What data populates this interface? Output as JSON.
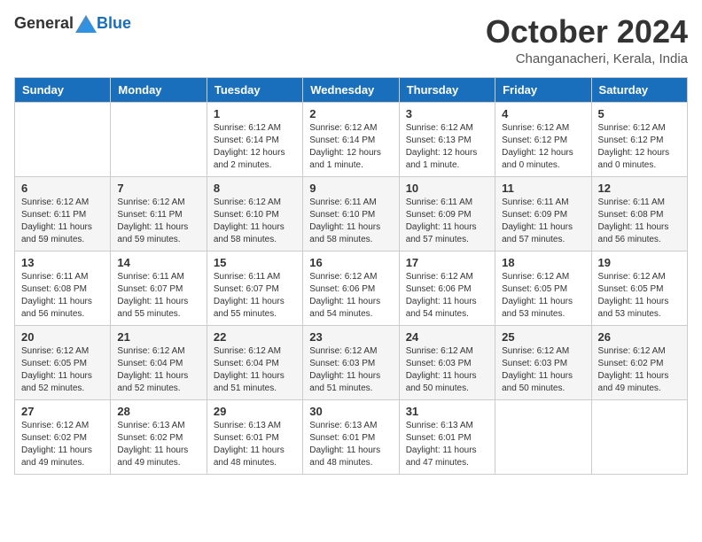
{
  "header": {
    "logo_general": "General",
    "logo_blue": "Blue",
    "month_title": "October 2024",
    "location": "Changanacheri, Kerala, India"
  },
  "calendar": {
    "days_of_week": [
      "Sunday",
      "Monday",
      "Tuesday",
      "Wednesday",
      "Thursday",
      "Friday",
      "Saturday"
    ],
    "weeks": [
      [
        {
          "day": "",
          "info": ""
        },
        {
          "day": "",
          "info": ""
        },
        {
          "day": "1",
          "info": "Sunrise: 6:12 AM\nSunset: 6:14 PM\nDaylight: 12 hours and 2 minutes."
        },
        {
          "day": "2",
          "info": "Sunrise: 6:12 AM\nSunset: 6:14 PM\nDaylight: 12 hours and 1 minute."
        },
        {
          "day": "3",
          "info": "Sunrise: 6:12 AM\nSunset: 6:13 PM\nDaylight: 12 hours and 1 minute."
        },
        {
          "day": "4",
          "info": "Sunrise: 6:12 AM\nSunset: 6:12 PM\nDaylight: 12 hours and 0 minutes."
        },
        {
          "day": "5",
          "info": "Sunrise: 6:12 AM\nSunset: 6:12 PM\nDaylight: 12 hours and 0 minutes."
        }
      ],
      [
        {
          "day": "6",
          "info": "Sunrise: 6:12 AM\nSunset: 6:11 PM\nDaylight: 11 hours and 59 minutes."
        },
        {
          "day": "7",
          "info": "Sunrise: 6:12 AM\nSunset: 6:11 PM\nDaylight: 11 hours and 59 minutes."
        },
        {
          "day": "8",
          "info": "Sunrise: 6:12 AM\nSunset: 6:10 PM\nDaylight: 11 hours and 58 minutes."
        },
        {
          "day": "9",
          "info": "Sunrise: 6:11 AM\nSunset: 6:10 PM\nDaylight: 11 hours and 58 minutes."
        },
        {
          "day": "10",
          "info": "Sunrise: 6:11 AM\nSunset: 6:09 PM\nDaylight: 11 hours and 57 minutes."
        },
        {
          "day": "11",
          "info": "Sunrise: 6:11 AM\nSunset: 6:09 PM\nDaylight: 11 hours and 57 minutes."
        },
        {
          "day": "12",
          "info": "Sunrise: 6:11 AM\nSunset: 6:08 PM\nDaylight: 11 hours and 56 minutes."
        }
      ],
      [
        {
          "day": "13",
          "info": "Sunrise: 6:11 AM\nSunset: 6:08 PM\nDaylight: 11 hours and 56 minutes."
        },
        {
          "day": "14",
          "info": "Sunrise: 6:11 AM\nSunset: 6:07 PM\nDaylight: 11 hours and 55 minutes."
        },
        {
          "day": "15",
          "info": "Sunrise: 6:11 AM\nSunset: 6:07 PM\nDaylight: 11 hours and 55 minutes."
        },
        {
          "day": "16",
          "info": "Sunrise: 6:12 AM\nSunset: 6:06 PM\nDaylight: 11 hours and 54 minutes."
        },
        {
          "day": "17",
          "info": "Sunrise: 6:12 AM\nSunset: 6:06 PM\nDaylight: 11 hours and 54 minutes."
        },
        {
          "day": "18",
          "info": "Sunrise: 6:12 AM\nSunset: 6:05 PM\nDaylight: 11 hours and 53 minutes."
        },
        {
          "day": "19",
          "info": "Sunrise: 6:12 AM\nSunset: 6:05 PM\nDaylight: 11 hours and 53 minutes."
        }
      ],
      [
        {
          "day": "20",
          "info": "Sunrise: 6:12 AM\nSunset: 6:05 PM\nDaylight: 11 hours and 52 minutes."
        },
        {
          "day": "21",
          "info": "Sunrise: 6:12 AM\nSunset: 6:04 PM\nDaylight: 11 hours and 52 minutes."
        },
        {
          "day": "22",
          "info": "Sunrise: 6:12 AM\nSunset: 6:04 PM\nDaylight: 11 hours and 51 minutes."
        },
        {
          "day": "23",
          "info": "Sunrise: 6:12 AM\nSunset: 6:03 PM\nDaylight: 11 hours and 51 minutes."
        },
        {
          "day": "24",
          "info": "Sunrise: 6:12 AM\nSunset: 6:03 PM\nDaylight: 11 hours and 50 minutes."
        },
        {
          "day": "25",
          "info": "Sunrise: 6:12 AM\nSunset: 6:03 PM\nDaylight: 11 hours and 50 minutes."
        },
        {
          "day": "26",
          "info": "Sunrise: 6:12 AM\nSunset: 6:02 PM\nDaylight: 11 hours and 49 minutes."
        }
      ],
      [
        {
          "day": "27",
          "info": "Sunrise: 6:12 AM\nSunset: 6:02 PM\nDaylight: 11 hours and 49 minutes."
        },
        {
          "day": "28",
          "info": "Sunrise: 6:13 AM\nSunset: 6:02 PM\nDaylight: 11 hours and 49 minutes."
        },
        {
          "day": "29",
          "info": "Sunrise: 6:13 AM\nSunset: 6:01 PM\nDaylight: 11 hours and 48 minutes."
        },
        {
          "day": "30",
          "info": "Sunrise: 6:13 AM\nSunset: 6:01 PM\nDaylight: 11 hours and 48 minutes."
        },
        {
          "day": "31",
          "info": "Sunrise: 6:13 AM\nSunset: 6:01 PM\nDaylight: 11 hours and 47 minutes."
        },
        {
          "day": "",
          "info": ""
        },
        {
          "day": "",
          "info": ""
        }
      ]
    ]
  }
}
